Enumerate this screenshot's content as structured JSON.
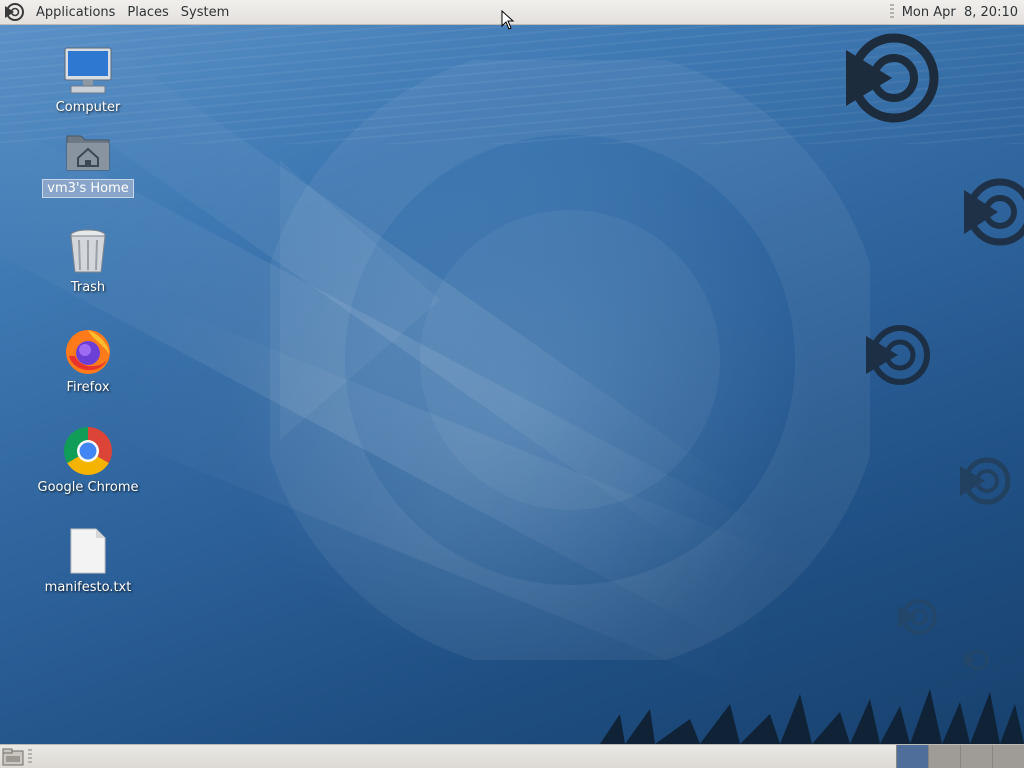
{
  "top_panel": {
    "menus": [
      "Applications",
      "Places",
      "System"
    ],
    "clock": "Mon Apr  8, 20:10"
  },
  "desktop": {
    "icons": [
      {
        "label": "Computer",
        "icon": "computer-icon"
      },
      {
        "label": "vm3's Home",
        "icon": "home-folder-icon",
        "selected": true
      },
      {
        "label": "Trash",
        "icon": "trash-icon"
      },
      {
        "label": "Firefox",
        "icon": "firefox-icon"
      },
      {
        "label": "Google Chrome",
        "icon": "chrome-icon"
      },
      {
        "label": "manifesto.txt",
        "icon": "text-file-icon"
      }
    ]
  },
  "bottom_panel": {
    "workspace_count": 4,
    "active_workspace": 1
  },
  "colors": {
    "panel_bg": "#e4e1dd",
    "selection": "#89a5c9",
    "desktop_blue": "#2e639c",
    "active_workspace": "#4f6f9a"
  }
}
